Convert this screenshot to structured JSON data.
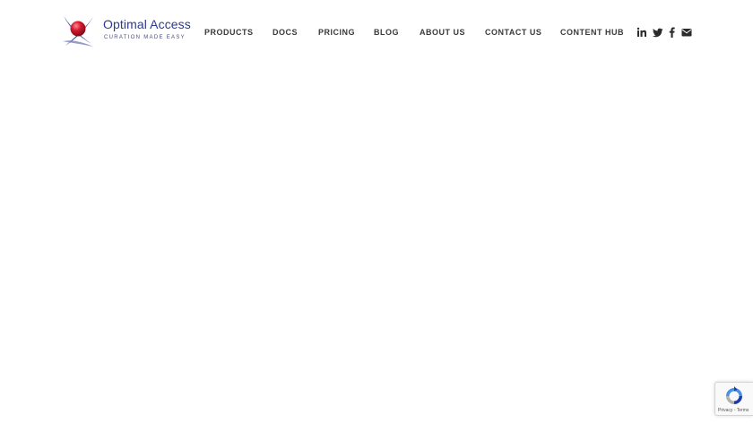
{
  "brand": {
    "name": "Optimal Access",
    "tagline": "CURATION MADE EASY",
    "logo_icon": "orb-logo-icon",
    "primary_color": "#2d3a8c",
    "accent_color": "#d3162c"
  },
  "nav": {
    "items": [
      {
        "label": "PRODUCTS"
      },
      {
        "label": "DOCS"
      },
      {
        "label": "PRICING"
      },
      {
        "label": "BLOG"
      },
      {
        "label": "ABOUT US"
      },
      {
        "label": "CONTACT US"
      },
      {
        "label": "CONTENT HUB"
      }
    ]
  },
  "social": {
    "icons": [
      "linkedin-icon",
      "twitter-icon",
      "facebook-icon",
      "email-icon"
    ]
  },
  "recaptcha": {
    "icon": "recaptcha-icon",
    "privacy": "Privacy",
    "separator": " - ",
    "terms": "Terms"
  }
}
